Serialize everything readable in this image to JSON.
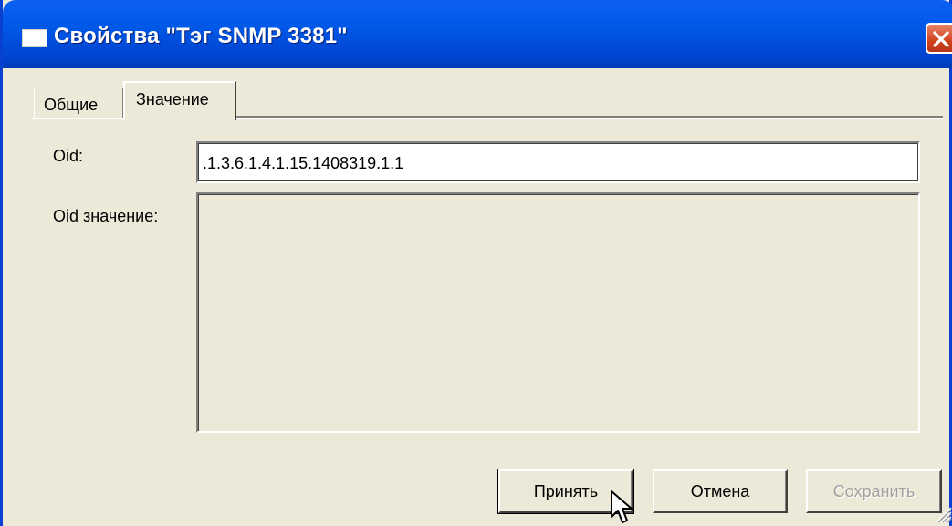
{
  "window": {
    "title": "Свойства  \"Тэг SNMP 3381\"",
    "title_icon": "window-icon",
    "close_icon": "close-icon",
    "accent_color": "#0058E6",
    "close_color": "#D1441D"
  },
  "tabs": [
    {
      "label": "Общие",
      "active": false
    },
    {
      "label": "Значение",
      "active": true
    }
  ],
  "form": {
    "oid_label": "Oid:",
    "oid_value": ".1.3.6.1.4.1.15.1408319.1.1",
    "oid_value_label": "Oid значение:",
    "oid_value_content": ""
  },
  "buttons": {
    "accept": "Принять",
    "cancel": "Отмена",
    "save": "Сохранить",
    "save_enabled": false
  }
}
